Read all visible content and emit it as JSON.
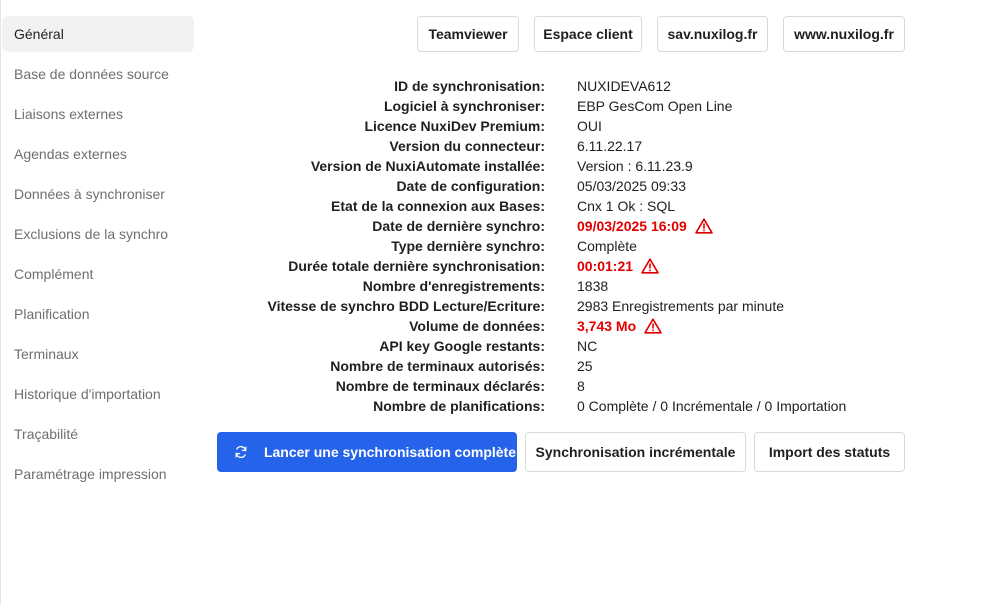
{
  "sidebar": {
    "items": [
      {
        "label": "Général",
        "active": true
      },
      {
        "label": "Base de données source"
      },
      {
        "label": "Liaisons externes"
      },
      {
        "label": "Agendas externes"
      },
      {
        "label": "Données à synchroniser"
      },
      {
        "label": "Exclusions de la synchro"
      },
      {
        "label": "Complément"
      },
      {
        "label": "Planification"
      },
      {
        "label": "Terminaux"
      },
      {
        "label": "Historique d'importation"
      },
      {
        "label": "Traçabilité"
      },
      {
        "label": "Paramétrage impression"
      }
    ]
  },
  "links": {
    "teamviewer": "Teamviewer",
    "espace_client": "Espace client",
    "sav": "sav.nuxilog.fr",
    "www": "www.nuxilog.fr"
  },
  "info": {
    "rows": [
      {
        "label": "ID de synchronisation:",
        "value": "NUXIDEVA612"
      },
      {
        "label": "Logiciel à synchroniser:",
        "value": "EBP GesCom Open Line"
      },
      {
        "label": "Licence NuxiDev Premium:",
        "value": "OUI"
      },
      {
        "label": "Version du connecteur:",
        "value": "6.11.22.17"
      },
      {
        "label": "Version de NuxiAutomate installée:",
        "value": "Version : 6.11.23.9"
      },
      {
        "label": "Date de configuration:",
        "value": "05/03/2025 09:33"
      },
      {
        "label": "Etat de la connexion aux Bases:",
        "value": "Cnx 1 Ok : SQL"
      },
      {
        "label": "Date de dernière synchro:",
        "value": "09/03/2025 16:09",
        "alert": true
      },
      {
        "label": "Type dernière synchro:",
        "value": "Complète"
      },
      {
        "label": "Durée totale dernière synchronisation:",
        "value": "00:01:21",
        "alert": true
      },
      {
        "label": "Nombre d'enregistrements:",
        "value": "1838"
      },
      {
        "label": "Vitesse de synchro BDD Lecture/Ecriture:",
        "value": "2983 Enregistrements par minute"
      },
      {
        "label": "Volume de données:",
        "value": "3,743 Mo",
        "alert": true
      },
      {
        "label": "API key Google restants:",
        "value": "NC"
      },
      {
        "label": "Nombre de terminaux autorisés:",
        "value": "25"
      },
      {
        "label": "Nombre de terminaux déclarés:",
        "value": "8"
      },
      {
        "label": "Nombre de planifications:",
        "value": "0 Complète / 0 Incrémentale / 0 Importation"
      }
    ]
  },
  "actions": {
    "full_sync": "Lancer une synchronisation complète",
    "incremental_sync": "Synchronisation incrémentale",
    "import_status": "Import des statuts"
  },
  "colors": {
    "primary": "#2563eb",
    "alert": "#e10000",
    "active_bg": "#f2f2f2"
  },
  "icons": {
    "warning": "warning-triangle-icon",
    "sync": "sync-arrows-icon"
  }
}
